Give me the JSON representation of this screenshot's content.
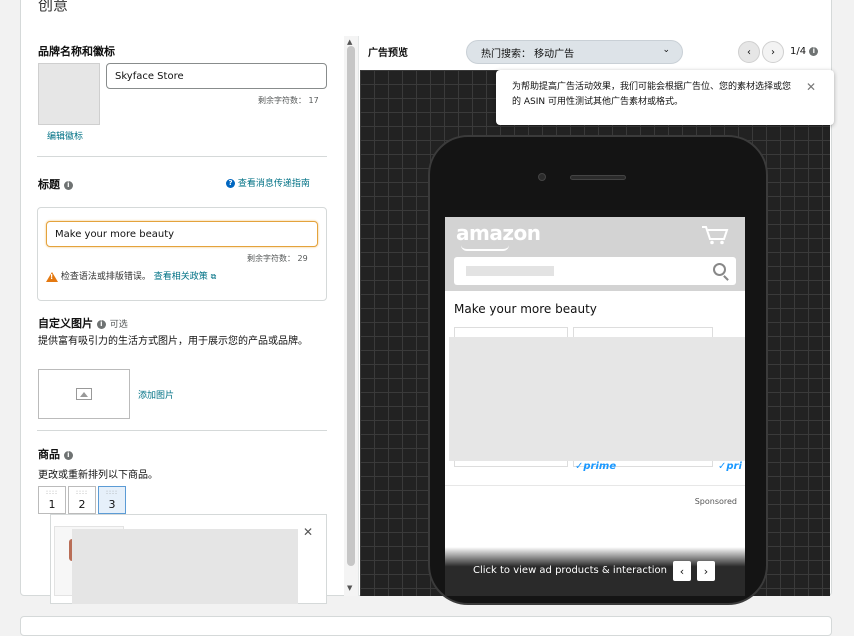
{
  "page": {
    "title": "创意"
  },
  "brand": {
    "title": "品牌名称和徽标",
    "name_value": "Skyface Store",
    "chars_left": "剩余字符数： 17",
    "edit_logo": "编辑徽标"
  },
  "headline": {
    "title": "标题",
    "guide_link": "查看消息传递指南",
    "value": "Make your more beauty",
    "chars_left": "剩余字符数： 29",
    "warning": "检查语法或排版错误。",
    "policy_link": "查看相关政策"
  },
  "custom_image": {
    "title": "自定义图片",
    "optional": "可选",
    "description": "提供富有吸引力的生活方式图片，用于展示您的产品或品牌。",
    "add_link": "添加图片"
  },
  "products": {
    "title": "商品",
    "description": "更改或重新排列以下商品。",
    "tabs": [
      "1",
      "2",
      "3"
    ],
    "active_tab": 3
  },
  "preview": {
    "label": "广告预览",
    "select_value": "热门搜索： 移动广告",
    "page_indicator": "1/4",
    "tooltip": "为帮助提高广告活动效果，我们可能会根据广告位、您的素材选择或您的 ASIN 可用性测试其他广告素材或格式。"
  },
  "phone": {
    "logo": "amazon",
    "headline": "Make your more beauty",
    "prime1": "✓prime",
    "prime2": "✓pri",
    "sponsored": "Sponsored",
    "cta": "Click to view ad products & interaction"
  },
  "icons": {
    "info": "info-icon",
    "warning": "warning-icon",
    "external": "external-link-icon",
    "image": "image-icon",
    "cart": "cart-icon",
    "search": "search-icon",
    "close": "close-icon"
  },
  "colors": {
    "link": "#007185",
    "warning": "#e47911",
    "prime": "#1a98ff",
    "accent_blue": "#0066c0"
  }
}
